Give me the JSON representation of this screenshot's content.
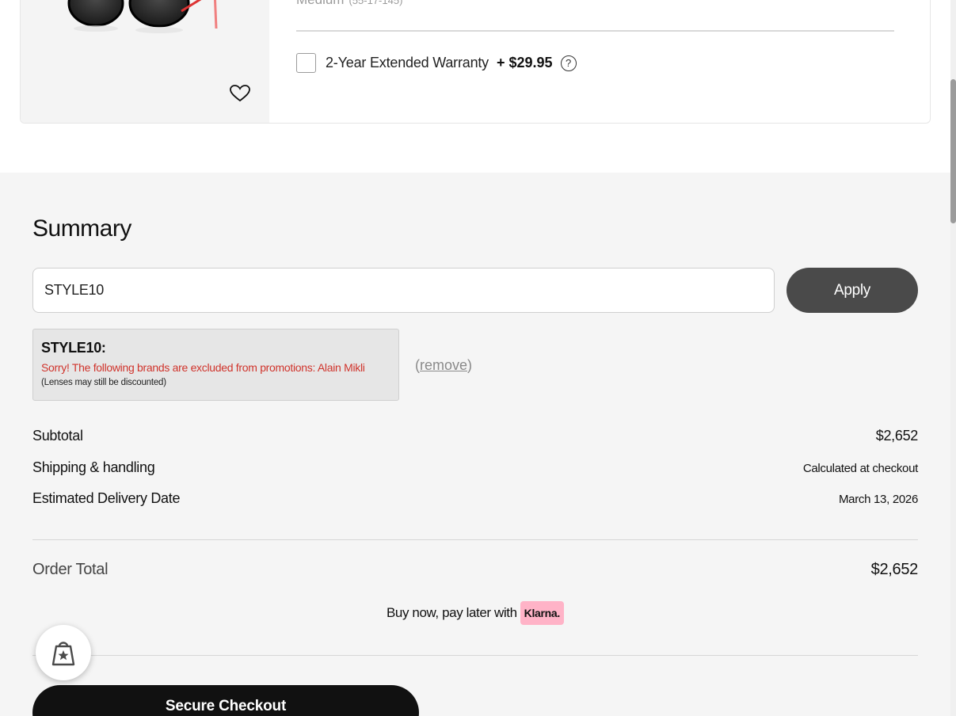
{
  "product": {
    "size_label": "Medium",
    "size_detail": "(55-17-145)",
    "warranty_label": "2-Year Extended Warranty",
    "warranty_price": "+ $29.95",
    "warranty_checked": false,
    "help_symbol": "?"
  },
  "summary": {
    "title": "Summary",
    "promo_input_value": "STYLE10",
    "apply_label": "Apply",
    "promo_error": {
      "code": "STYLE10:",
      "message": "Sorry! The following brands are excluded from promotions: Alain Mikli",
      "note": "(Lenses may still be discounted)"
    },
    "remove_open": "(",
    "remove_label": "remove",
    "remove_close": ")",
    "rows": {
      "subtotal": {
        "label": "Subtotal",
        "value": "$2,652"
      },
      "shipping": {
        "label": "Shipping & handling",
        "value": "Calculated at checkout"
      },
      "delivery": {
        "label": "Estimated Delivery Date",
        "value": "March 13, 2026"
      }
    },
    "order_total": {
      "label": "Order Total",
      "value": "$2,652"
    },
    "klarna": {
      "text": "Buy now, pay later with",
      "badge": "Klarna."
    },
    "checkout_label": "Secure Checkout"
  },
  "icons": {
    "wishlist": "heart-icon",
    "help": "question-circle-icon",
    "floating": "shopping-bag-star-icon"
  },
  "colors": {
    "error": "#d0342c",
    "apply_bg": "#4a4a4a",
    "checkout_bg": "#111111",
    "klarna_pink": "#ffb3c7",
    "summary_bg": "#f5f5f5"
  }
}
